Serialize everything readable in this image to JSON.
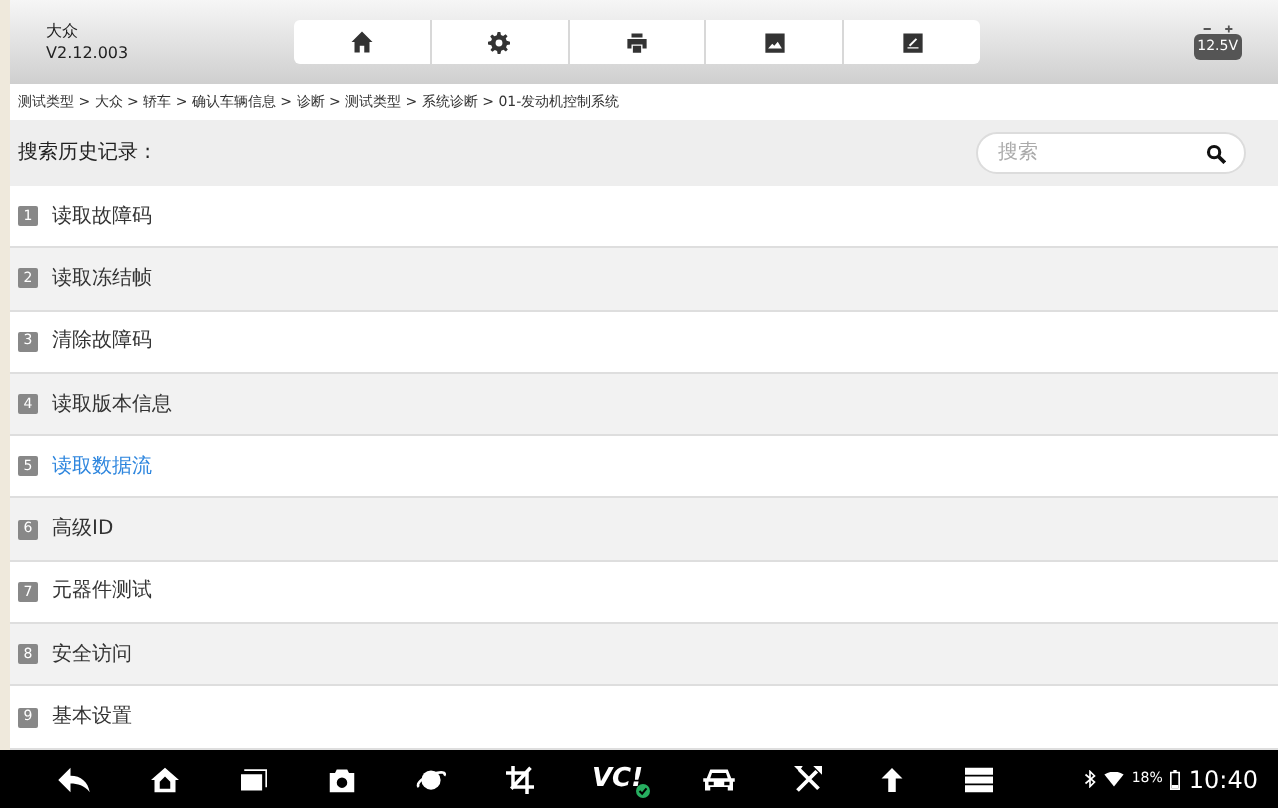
{
  "header": {
    "brand": "大众",
    "version": "V2.12.003",
    "voltage": "12.5V"
  },
  "breadcrumb": "测试类型 > 大众 > 轿车 > 确认车辆信息 > 诊断 > 测试类型 > 系统诊断 > 01-发动机控制系统",
  "search": {
    "label": "搜索历史记录 :",
    "placeholder": "搜索"
  },
  "menu": [
    {
      "number": "1",
      "label": "读取故障码",
      "selected": false
    },
    {
      "number": "2",
      "label": "读取冻结帧",
      "selected": false
    },
    {
      "number": "3",
      "label": "清除故障码",
      "selected": false
    },
    {
      "number": "4",
      "label": "读取版本信息",
      "selected": false
    },
    {
      "number": "5",
      "label": "读取数据流",
      "selected": true
    },
    {
      "number": "6",
      "label": "高级ID",
      "selected": false
    },
    {
      "number": "7",
      "label": "元器件测试",
      "selected": false
    },
    {
      "number": "8",
      "label": "安全访问",
      "selected": false
    },
    {
      "number": "9",
      "label": "基本设置",
      "selected": false
    }
  ],
  "nav_bar": {
    "vci_label": "VC!",
    "battery_percent": "18%",
    "time": "10:40"
  }
}
